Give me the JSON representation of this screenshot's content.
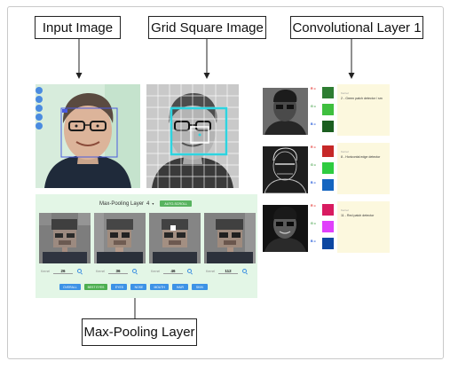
{
  "callouts": {
    "input_image": "Input Image",
    "grid_square_image": "Grid Square Image",
    "convolutional_layer": "Convolutional Layer 1",
    "max_pooling_layer": "Max-Pooling Layer"
  },
  "max_pooling": {
    "title": "Max-Pooling Layer",
    "layer_value": "4",
    "auto_button": "AUTO-SCROLL",
    "filter_label": "Kernel",
    "filters": [
      "26",
      "36",
      "46",
      "112"
    ],
    "buttons": [
      {
        "label": "OVERALL",
        "color": "#3d92e6"
      },
      {
        "label": "BEST EYES",
        "color": "#4caf50"
      },
      {
        "label": "EYES",
        "color": "#3d92e6"
      },
      {
        "label": "NOSE",
        "color": "#3d92e6"
      },
      {
        "label": "MOUTH",
        "color": "#3d92e6"
      },
      {
        "label": "HAIR",
        "color": "#3d92e6"
      },
      {
        "label": "SKIN",
        "color": "#3d92e6"
      }
    ]
  },
  "conv": {
    "rgb_labels": [
      "R =",
      "G =",
      "B ="
    ],
    "rgb_colors": [
      "#e53935",
      "#43a047",
      "#1e56d8"
    ],
    "kernel_label": "Kernel",
    "rows": [
      {
        "text": "2 - Green patch detector / sm",
        "kernels": [
          "#2e7d32",
          "#3fbf3f",
          "#1b5e20"
        ]
      },
      {
        "text": "8 - Horizontal edge detector",
        "kernels": [
          "#c62828",
          "#2ecc40",
          "#1565c0"
        ]
      },
      {
        "text": "11 - Red patch detector",
        "kernels": [
          "#d81b60",
          "#e040fb",
          "#0d47a1"
        ]
      }
    ]
  },
  "colors": {
    "input_bg": "#cfe9d6",
    "maxpool_bg": "#e3f6e6",
    "conv_card_bg": "#fcf8de",
    "grid_highlight": "#2dd4e0",
    "input_box": "#4a5be0"
  }
}
